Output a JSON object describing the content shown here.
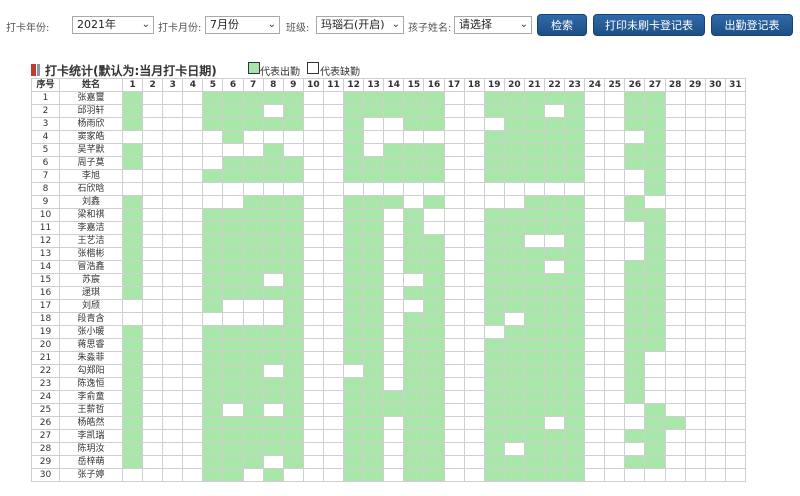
{
  "filters": {
    "year_label": "打卡年份:",
    "year_value": "2021年",
    "month_label": "打卡月份:",
    "month_value": "7月份",
    "class_label": "班级:",
    "class_value": "玛瑙石(开启)",
    "child_label": "孩子姓名:",
    "child_value": "请选择"
  },
  "buttons": {
    "search": "检索",
    "print_unswiped": "打印未刷卡登记表",
    "attendance_register": "出勤登记表"
  },
  "section": {
    "title": "打卡统计(默认为:当月打卡日期)",
    "legend_present": "代表出勤",
    "legend_absent": "代表缺勤"
  },
  "colors": {
    "present": "#a9e6a9",
    "absent": "#ffffff",
    "button": "#1d4f86",
    "title_marker": "#c23a2c"
  },
  "table": {
    "col_index": "序号",
    "col_name": "姓名",
    "days": [
      "1",
      "2",
      "3",
      "4",
      "5",
      "6",
      "7",
      "8",
      "9",
      "10",
      "11",
      "12",
      "13",
      "14",
      "15",
      "16",
      "17",
      "18",
      "19",
      "20",
      "21",
      "22",
      "23",
      "24",
      "25",
      "26",
      "27",
      "28",
      "29",
      "30",
      "31"
    ],
    "rows": [
      {
        "no": "1",
        "name": "张嘉璽",
        "present": [
          1,
          5,
          6,
          7,
          8,
          9,
          12,
          13,
          14,
          15,
          16,
          19,
          20,
          21,
          22,
          23,
          26,
          27
        ]
      },
      {
        "no": "2",
        "name": "邱羽轩",
        "present": [
          1,
          5,
          6,
          7,
          9,
          12,
          13,
          14,
          15,
          16,
          19,
          20,
          21,
          23,
          26,
          27
        ]
      },
      {
        "no": "3",
        "name": "杨雨欣",
        "present": [
          1,
          5,
          6,
          7,
          8,
          9,
          12,
          15,
          16,
          20,
          21,
          22,
          23,
          26,
          27
        ]
      },
      {
        "no": "4",
        "name": "窦家皓",
        "present": [
          6,
          12,
          19,
          20,
          21,
          22,
          23,
          27
        ]
      },
      {
        "no": "5",
        "name": "吴芊默",
        "present": [
          1,
          8,
          12,
          14,
          15,
          16,
          19,
          20,
          21,
          22,
          23,
          26,
          27
        ]
      },
      {
        "no": "6",
        "name": "周子莫",
        "present": [
          1,
          6,
          7,
          8,
          9,
          12,
          13,
          14,
          15,
          16,
          19,
          20,
          21,
          22,
          23,
          26,
          27
        ]
      },
      {
        "no": "7",
        "name": "李旭",
        "present": [
          5,
          6,
          7,
          8,
          9,
          12,
          13,
          14,
          15,
          16,
          19,
          20,
          21,
          22,
          23,
          27
        ]
      },
      {
        "no": "8",
        "name": "石欣晗",
        "present": [
          27
        ]
      },
      {
        "no": "9",
        "name": "刘鑫",
        "present": [
          1,
          7,
          8,
          9,
          12,
          13,
          14,
          16,
          21,
          22,
          23,
          26
        ]
      },
      {
        "no": "10",
        "name": "梁和祺",
        "present": [
          1,
          5,
          6,
          7,
          8,
          9,
          12,
          13,
          15,
          19,
          20,
          21,
          22,
          23,
          26,
          27
        ]
      },
      {
        "no": "11",
        "name": "李嘉洁",
        "present": [
          1,
          5,
          6,
          7,
          8,
          9,
          12,
          13,
          15,
          19,
          20,
          21,
          22,
          23,
          27
        ]
      },
      {
        "no": "12",
        "name": "王艺洁",
        "present": [
          1,
          5,
          6,
          7,
          8,
          9,
          12,
          13,
          15,
          16,
          19,
          20,
          23,
          27
        ]
      },
      {
        "no": "13",
        "name": "张楷彬",
        "present": [
          1,
          5,
          6,
          7,
          8,
          9,
          12,
          13,
          15,
          16,
          19,
          20,
          21,
          22,
          23,
          27
        ]
      },
      {
        "no": "14",
        "name": "冒浩鑫",
        "present": [
          1,
          5,
          6,
          7,
          8,
          9,
          12,
          13,
          15,
          16,
          19,
          20,
          21,
          23,
          26,
          27
        ]
      },
      {
        "no": "15",
        "name": "苏宸",
        "present": [
          1,
          5,
          6,
          7,
          9,
          12,
          13,
          16,
          19,
          20,
          21,
          22,
          23,
          26,
          27
        ]
      },
      {
        "no": "16",
        "name": "逯琪",
        "present": [
          1,
          5,
          6,
          7,
          8,
          9,
          12,
          13,
          15,
          16,
          19,
          20,
          21,
          22,
          23,
          26,
          27
        ]
      },
      {
        "no": "17",
        "name": "刘颀",
        "present": [
          5,
          9,
          12,
          13,
          16,
          19,
          20,
          21,
          22,
          23,
          26,
          27
        ]
      },
      {
        "no": "18",
        "name": "段青含",
        "present": [
          9,
          12,
          13,
          15,
          16,
          19,
          21,
          22,
          23,
          26,
          27
        ]
      },
      {
        "no": "19",
        "name": "张小暖",
        "present": [
          1,
          5,
          6,
          7,
          8,
          9,
          12,
          13,
          15,
          16,
          20,
          21,
          22,
          23,
          26,
          27
        ]
      },
      {
        "no": "20",
        "name": "蒋思睿",
        "present": [
          1,
          5,
          6,
          7,
          8,
          9,
          12,
          13,
          15,
          16,
          19,
          20,
          21,
          22,
          23,
          26,
          27
        ]
      },
      {
        "no": "21",
        "name": "朱淼菲",
        "present": [
          1,
          5,
          6,
          7,
          8,
          9,
          12,
          13,
          15,
          16,
          19,
          20,
          21,
          22,
          23,
          26
        ]
      },
      {
        "no": "22",
        "name": "勾郑阳",
        "present": [
          1,
          5,
          6,
          7,
          9,
          13,
          15,
          16,
          19,
          20,
          21,
          22,
          23,
          26
        ]
      },
      {
        "no": "23",
        "name": "陈逸恒",
        "present": [
          1,
          5,
          6,
          7,
          8,
          9,
          12,
          13,
          15,
          16,
          19,
          20,
          21,
          22,
          23,
          26
        ]
      },
      {
        "no": "24",
        "name": "李俞童",
        "present": [
          1,
          5,
          6,
          7,
          8,
          9,
          12,
          13,
          14,
          15,
          16,
          19,
          20,
          21,
          22,
          23,
          26
        ]
      },
      {
        "no": "25",
        "name": "王薪哲",
        "present": [
          1,
          5,
          7,
          9,
          12,
          13,
          14,
          15,
          16,
          19,
          20,
          21,
          22,
          23,
          27
        ]
      },
      {
        "no": "26",
        "name": "杨皓然",
        "present": [
          1,
          5,
          6,
          7,
          8,
          9,
          12,
          13,
          15,
          16,
          19,
          20,
          21,
          23,
          27,
          28
        ]
      },
      {
        "no": "27",
        "name": "李凯瑞",
        "present": [
          1,
          5,
          6,
          7,
          8,
          9,
          12,
          13,
          15,
          16,
          19,
          20,
          21,
          22,
          23,
          26,
          27
        ]
      },
      {
        "no": "28",
        "name": "陈玥汝",
        "present": [
          1,
          5,
          6,
          7,
          8,
          9,
          12,
          13,
          15,
          16,
          19,
          21,
          22,
          23,
          27
        ]
      },
      {
        "no": "29",
        "name": "岳梓萌",
        "present": [
          1,
          5,
          6,
          7,
          9,
          12,
          13,
          15,
          16,
          19,
          20,
          21,
          22,
          23,
          26,
          27
        ]
      },
      {
        "no": "30",
        "name": "张子婷",
        "present": [
          5,
          6,
          8,
          12,
          13,
          15,
          16,
          19,
          20,
          21,
          22,
          23
        ]
      }
    ]
  }
}
